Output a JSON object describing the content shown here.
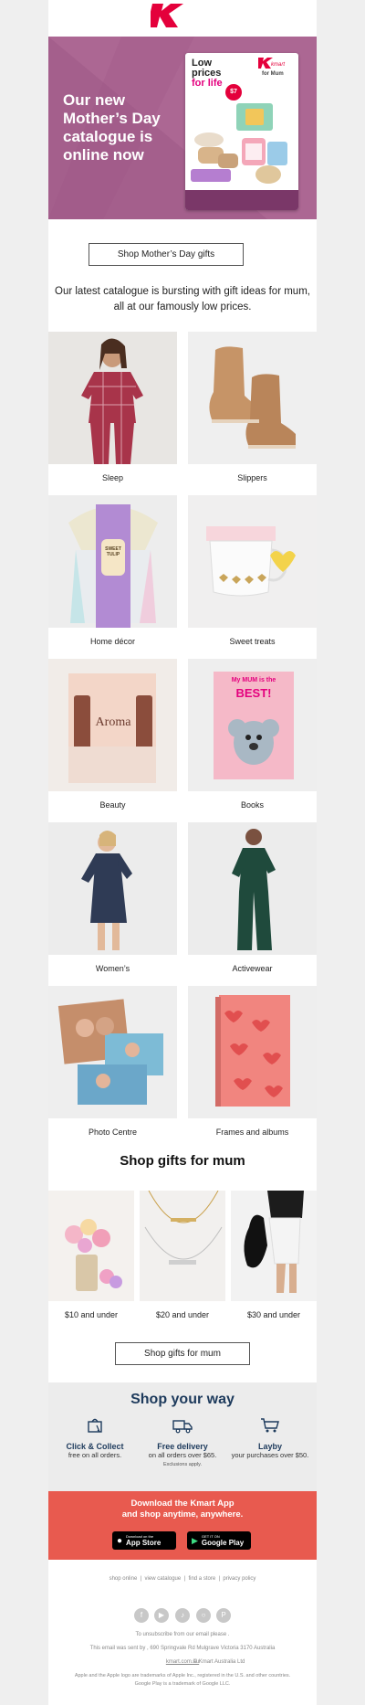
{
  "brand": {
    "logo_text": "kmart",
    "accent": "#e4003b"
  },
  "hero": {
    "headline": "Our new Mother’s Day catalogue is online now",
    "bg": "#a45f8c",
    "catalogue": {
      "line1": "Low",
      "line2": "prices",
      "line3": "for life",
      "brand": "kmart",
      "tag": "for Mum",
      "price": "$7"
    }
  },
  "cta_primary": "Shop Mother’s Day gifts",
  "intro": "Our latest catalogue is bursting with gift ideas for mum, all at our famously low prices.",
  "categories": [
    {
      "label": "Sleep",
      "icon": "pyjamas-icon"
    },
    {
      "label": "Slippers",
      "icon": "slippers-icon"
    },
    {
      "label": "Home décor",
      "icon": "candle-icon"
    },
    {
      "label": "Sweet treats",
      "icon": "mug-icon"
    },
    {
      "label": "Beauty",
      "icon": "aroma-icon"
    },
    {
      "label": "Books",
      "icon": "book-icon"
    },
    {
      "label": "Women’s",
      "icon": "dress-icon"
    },
    {
      "label": "Activewear",
      "icon": "jumpsuit-icon"
    },
    {
      "label": "Photo Centre",
      "icon": "photo-icon"
    },
    {
      "label": "Frames and albums",
      "icon": "album-icon"
    }
  ],
  "product_texts": {
    "candle": "SWEET TULIP",
    "aroma": "Aroma",
    "book1": "My MUM is the",
    "book2": "BEST!"
  },
  "gifts": {
    "title": "Shop gifts for mum",
    "items": [
      {
        "label": "$10 and under",
        "icon": "flowers-icon"
      },
      {
        "label": "$20 and under",
        "icon": "necklace-icon"
      },
      {
        "label": "$30 and under",
        "icon": "handbag-icon"
      }
    ],
    "cta": "Shop gifts for mum"
  },
  "shop_your_way": {
    "title": "Shop your way",
    "items": [
      {
        "title": "Click & Collect",
        "sub": "free on all orders.",
        "note": "",
        "icon": "click-collect-icon"
      },
      {
        "title": "Free delivery",
        "sub": "on all orders over $65.",
        "note": "Exclusions apply.",
        "icon": "truck-icon"
      },
      {
        "title": "Layby",
        "sub": "your purchases over $50.",
        "note": "",
        "icon": "cart-icon"
      }
    ]
  },
  "app": {
    "line1": "Download the Kmart App",
    "line2": "and shop anytime, anywhere.",
    "apple": {
      "small": "Download on the",
      "big": "App Store"
    },
    "google": {
      "small": "GET IT ON",
      "big": "Google Play"
    }
  },
  "footer": {
    "links": [
      "shop online",
      "view catalogue",
      "find a store",
      "privacy policy"
    ],
    "social": [
      "facebook-icon",
      "youtube-icon",
      "tiktok-icon",
      "instagram-icon",
      "pinterest-icon"
    ],
    "unsubscribe": "To unsubscribe from our email please .",
    "sent_by": "This email was sent by , 690 Springvale Rd Mulgrave Victoria 3170 Australia",
    "site": "kmart.com.au",
    "copyright": "© Kmart Australia Ltd",
    "legal1": "Apple and the Apple logo are trademarks of Apple Inc., registered in the U.S. and other countries.",
    "legal2": "Google Play is a trademark of Google LLC."
  }
}
